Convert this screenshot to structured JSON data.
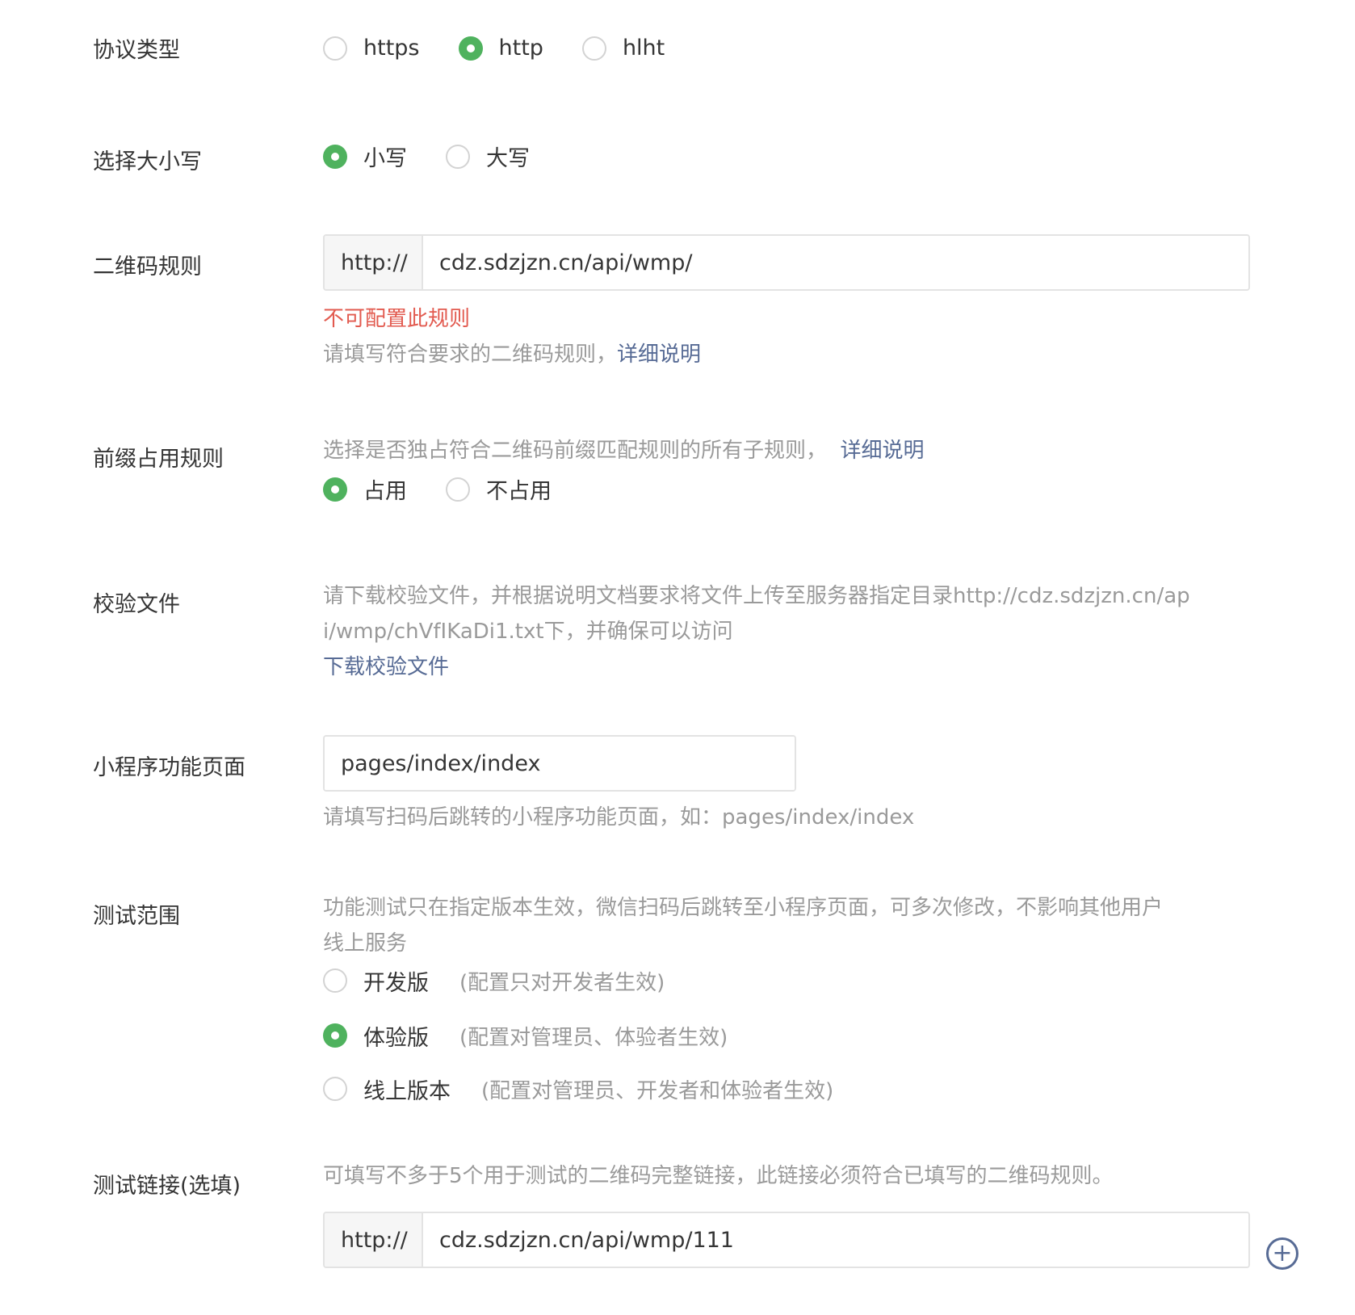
{
  "protocol": {
    "label": "协议类型",
    "options": [
      {
        "text": "https",
        "checked": false
      },
      {
        "text": "http",
        "checked": true
      },
      {
        "text": "hlht",
        "checked": false
      }
    ]
  },
  "case": {
    "label": "选择大小写",
    "options": [
      {
        "text": "小写",
        "checked": true
      },
      {
        "text": "大写",
        "checked": false
      }
    ]
  },
  "qr_rule": {
    "label": "二维码规则",
    "prefix": "http://",
    "value": "cdz.sdzjzn.cn/api/wmp/",
    "error": "不可配置此规则",
    "hint": "请填写符合要求的二维码规则，",
    "link": "详细说明"
  },
  "prefix_rule": {
    "label": "前缀占用规则",
    "desc": "选择是否独占符合二维码前缀匹配规则的所有子规则，",
    "link": "详细说明",
    "options": [
      {
        "text": "占用",
        "checked": true
      },
      {
        "text": "不占用",
        "checked": false
      }
    ]
  },
  "verify_file": {
    "label": "校验文件",
    "desc_line1": "请下载校验文件，并根据说明文档要求将文件上传至服务器指定目录http://cdz.sdzjzn.cn/ap",
    "desc_line2": "i/wmp/chVfIKaDi1.txt下，并确保可以访问",
    "link": "下载校验文件"
  },
  "page": {
    "label": "小程序功能页面",
    "value": "pages/index/index",
    "hint": "请填写扫码后跳转的小程序功能页面，如：pages/index/index"
  },
  "test_scope": {
    "label": "测试范围",
    "desc_line1": "功能测试只在指定版本生效，微信扫码后跳转至小程序页面，可多次修改，不影响其他用户",
    "desc_line2": "线上服务",
    "options": [
      {
        "text": "开发版",
        "note": "(配置只对开发者生效)",
        "checked": false
      },
      {
        "text": "体验版",
        "note": "(配置对管理员、体验者生效)",
        "checked": true
      },
      {
        "text": "线上版本",
        "note": "(配置对管理员、开发者和体验者生效)",
        "checked": false
      }
    ]
  },
  "test_link": {
    "label": "测试链接(选填)",
    "desc": "可填写不多于5个用于测试的二维码完整链接，此链接必须符合已填写的二维码规则。",
    "prefix": "http://",
    "value": "cdz.sdzjzn.cn/api/wmp/111",
    "add_icon": "plus-circle-icon"
  },
  "colors": {
    "accent_green": "#4fb25e",
    "link_blue": "#576b95",
    "error_red": "#e25a4f",
    "hint_gray": "#9a9a9a"
  }
}
